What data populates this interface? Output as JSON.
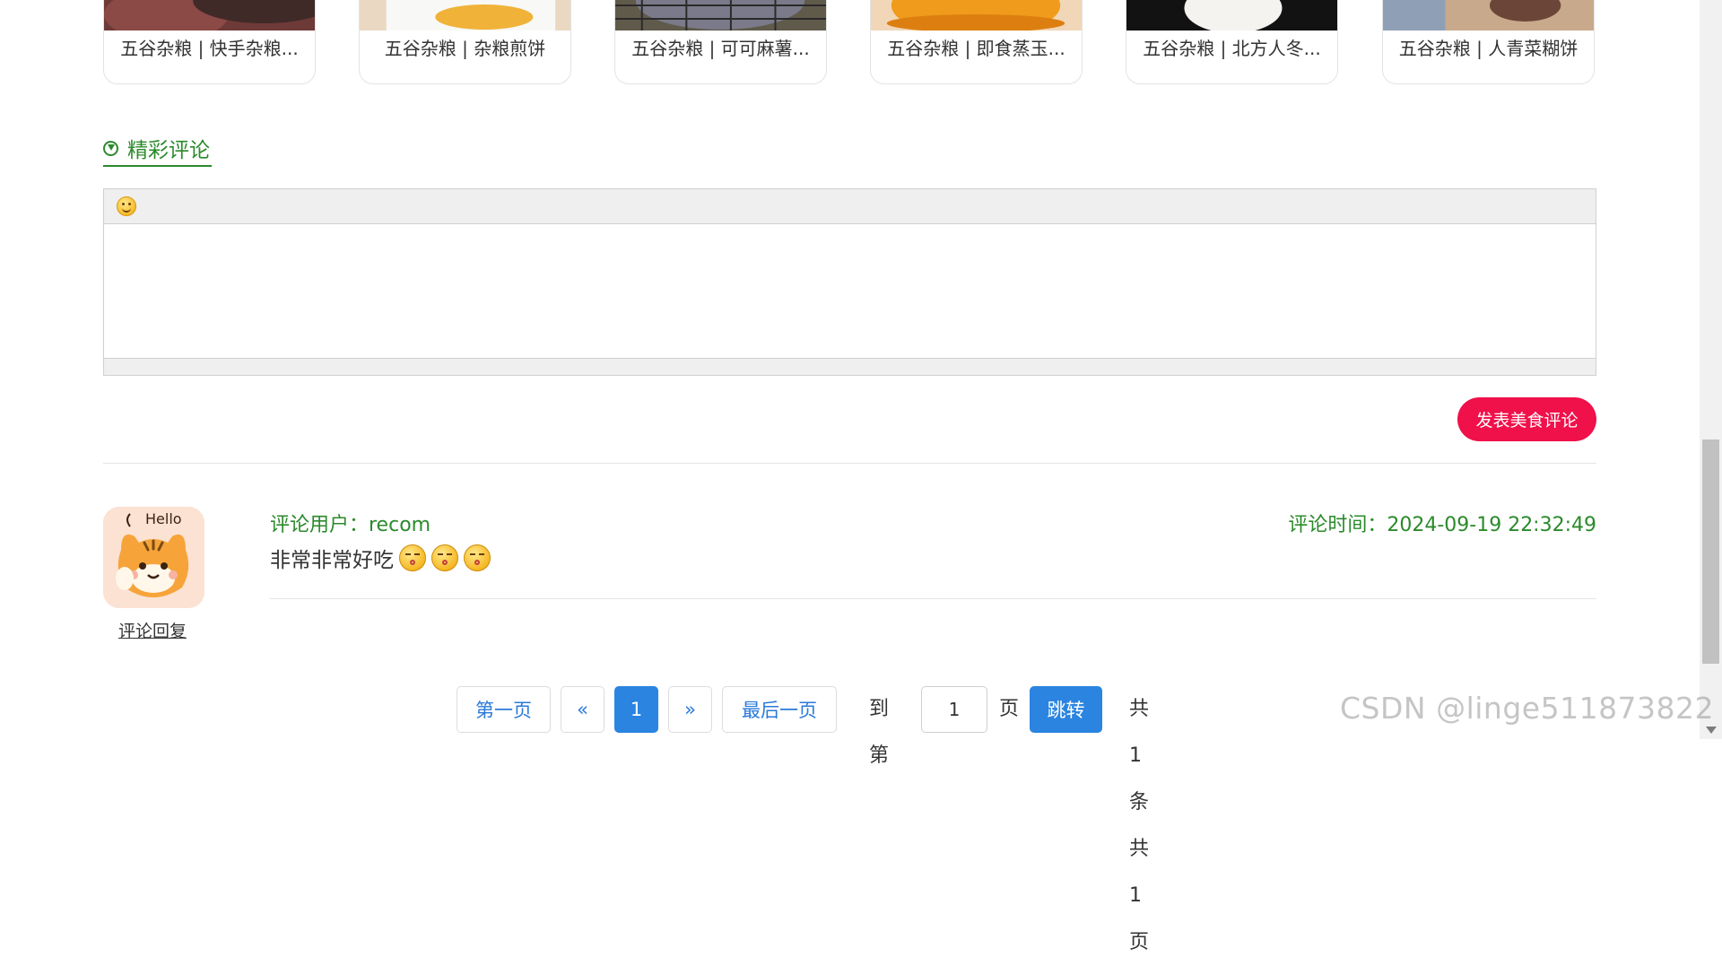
{
  "recipes": [
    {
      "title": "五谷杂粮 | 快手杂粮...",
      "thumb": "dark red-brown"
    },
    {
      "title": "五谷杂粮 | 杂粮煎饼",
      "thumb": "white plate, yellow"
    },
    {
      "title": "五谷杂粮 | 可可麻薯...",
      "thumb": "cooling rack"
    },
    {
      "title": "五谷杂粮 | 即食蒸玉...",
      "thumb": "orange bowl"
    },
    {
      "title": "五谷杂粮 | 北方人冬...",
      "thumb": "dark with white bowl"
    },
    {
      "title": "五谷杂粮 | 人青菜糊饼",
      "thumb": "tan with dark item"
    }
  ],
  "section": {
    "title": "精彩评论",
    "icon": "arrow-circle-down-icon"
  },
  "editor": {
    "toolbar_icon": "emoji-smile-icon",
    "content": ""
  },
  "submit": {
    "label": "发表美食评论"
  },
  "comment": {
    "user_label": "评论用户：recom",
    "time_label": "评论时间：2024-09-19 22:32:49",
    "text": "非常非常好吃",
    "emojis": [
      "kiss-emoji-icon",
      "kiss-emoji-icon",
      "kiss-emoji-icon"
    ],
    "avatar_text": "Hello",
    "reply_label": "评论回复"
  },
  "pagination": {
    "first": "第一页",
    "prev": "«",
    "current": "1",
    "next": "»",
    "last": "最后一页",
    "goto_prefix": "到第",
    "goto_value": "1",
    "goto_suffix": "页",
    "goto_button": "跳转",
    "summary": "共1条 共1页"
  },
  "watermark": "CSDN @linge511873822",
  "colors": {
    "accent_green": "#2b8a2b",
    "submit_red": "#f0104a",
    "pager_blue": "#2a84e0"
  }
}
